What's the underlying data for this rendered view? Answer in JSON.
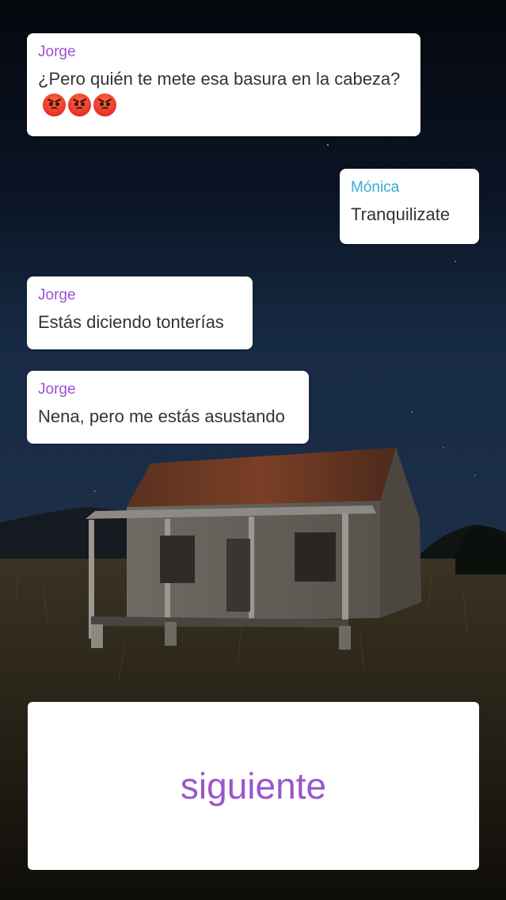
{
  "messages": [
    {
      "sender": "Jorge",
      "text": "¿Pero quién te mete esa basura en la cabeza?",
      "emoji": "angry-face-emoji x3"
    },
    {
      "sender": "Mónica",
      "text": "Tranquilizate"
    },
    {
      "sender": "Jorge",
      "text": "Estás diciendo tonterías"
    },
    {
      "sender": "Jorge",
      "text": "Nena, pero me estás asustando"
    }
  ],
  "next_button": {
    "label": "siguiente"
  },
  "colors": {
    "jorge_name": "#a04fd3",
    "monica_name": "#3aa9d8",
    "button_text": "#9a55cc",
    "bubble_bg": "#ffffff"
  }
}
